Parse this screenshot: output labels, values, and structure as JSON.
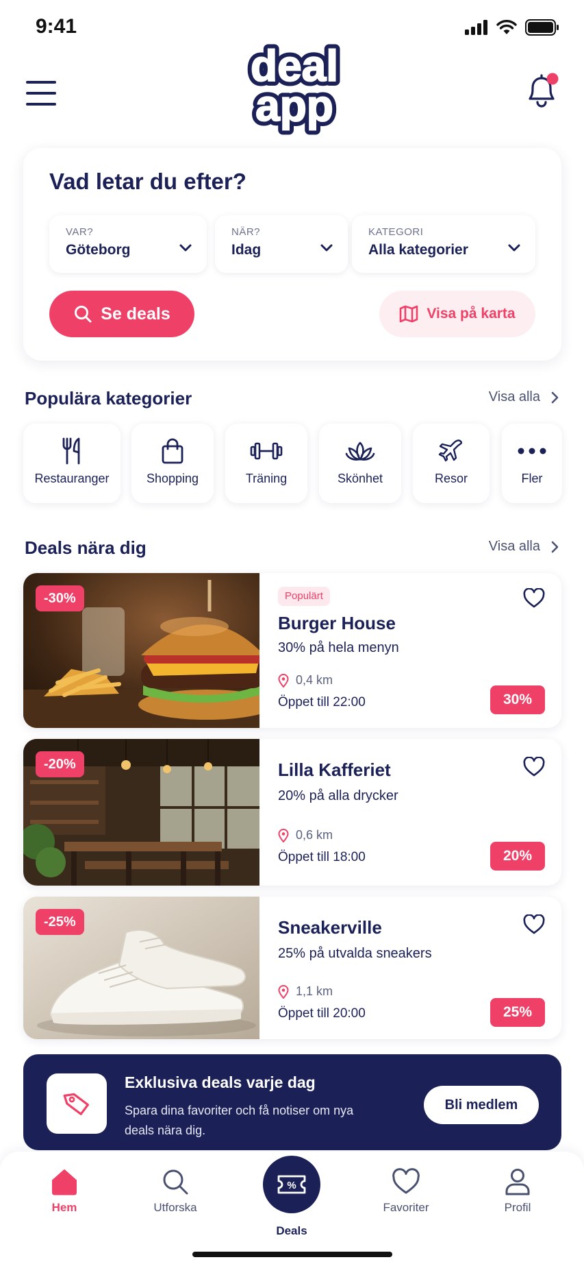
{
  "status_bar": {
    "time": "9:41"
  },
  "header": {
    "logo_line1": "deal",
    "logo_line2": "app",
    "has_notification": true
  },
  "search": {
    "title": "Vad letar du efter?",
    "fields": [
      {
        "label": "VAR?",
        "value": "Göteborg"
      },
      {
        "label": "NÄR?",
        "value": "Idag"
      },
      {
        "label": "KATEGORI",
        "value": "Alla kategorier"
      }
    ],
    "primary_button": "Se deals",
    "secondary_button": "Visa på karta"
  },
  "categories": {
    "title": "Populära kategorier",
    "see_all": "Visa alla",
    "items": [
      {
        "label": "Restauranger",
        "icon": "fork-knife-icon"
      },
      {
        "label": "Shopping",
        "icon": "shopping-bag-icon"
      },
      {
        "label": "Träning",
        "icon": "dumbbell-icon"
      },
      {
        "label": "Skönhet",
        "icon": "lotus-icon"
      },
      {
        "label": "Resor",
        "icon": "airplane-icon"
      },
      {
        "label": "Fler",
        "icon": "more-icon"
      }
    ]
  },
  "deals": {
    "title": "Deals nära dig",
    "see_all": "Visa alla",
    "items": [
      {
        "badge": "-30%",
        "tag": "Populärt",
        "name": "Burger House",
        "offer": "30% på hela menyn",
        "distance": "0,4 km",
        "hours": "Öppet till 22:00",
        "pill": "30%",
        "image": "burger-photo"
      },
      {
        "badge": "-20%",
        "tag": "",
        "name": "Lilla Kafferiet",
        "offer": "20% på alla drycker",
        "distance": "0,6 km",
        "hours": "Öppet till 18:00",
        "pill": "20%",
        "image": "cafe-photo"
      },
      {
        "badge": "-25%",
        "tag": "",
        "name": "Sneakerville",
        "offer": "25% på utvalda sneakers",
        "distance": "1,1 km",
        "hours": "Öppet till 20:00",
        "pill": "25%",
        "image": "sneakers-photo"
      }
    ]
  },
  "banner": {
    "title": "Exklusiva deals varje dag",
    "text": "Spara dina favoriter och få notiser om nya deals nära dig.",
    "button": "Bli medlem"
  },
  "bottom_nav": {
    "items": [
      {
        "label": "Hem",
        "icon": "home-icon",
        "active": true
      },
      {
        "label": "Utforska",
        "icon": "search-icon"
      },
      {
        "label": "Deals",
        "icon": "ticket-percent-icon"
      },
      {
        "label": "Favoriter",
        "icon": "heart-icon"
      },
      {
        "label": "Profil",
        "icon": "user-icon"
      }
    ]
  },
  "colors": {
    "accent": "#ef4168",
    "navy": "#1b2157",
    "accent_soft": "#fdeef1"
  }
}
